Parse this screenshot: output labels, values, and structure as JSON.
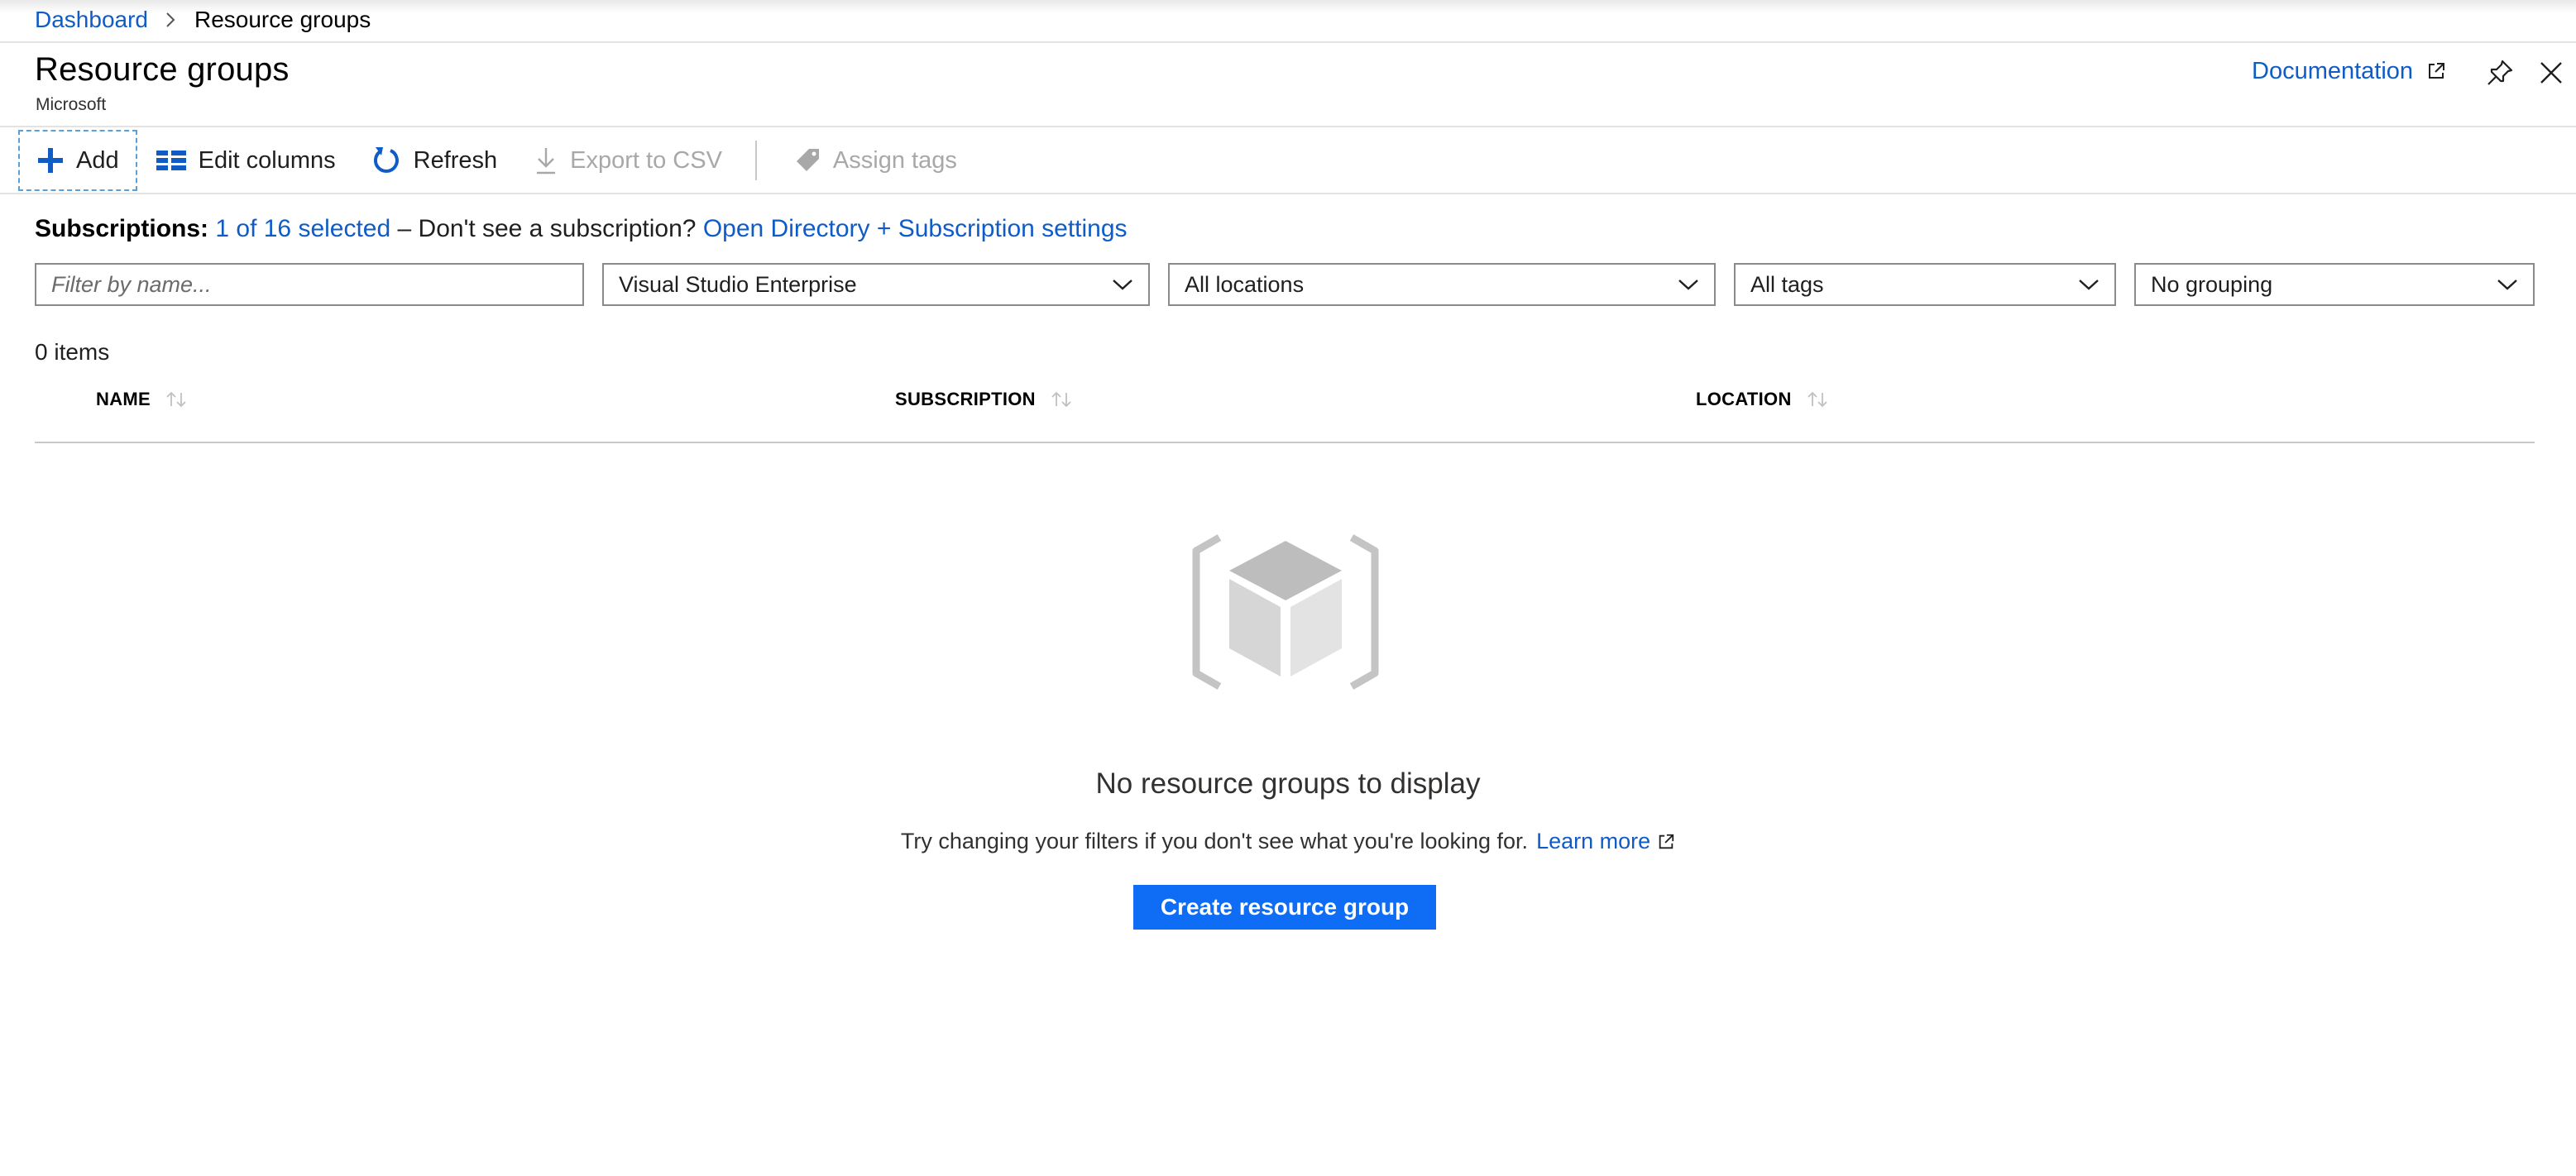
{
  "breadcrumb": {
    "root": "Dashboard",
    "current": "Resource groups"
  },
  "header": {
    "title": "Resource groups",
    "subtitle": "Microsoft",
    "documentation": "Documentation"
  },
  "toolbar": {
    "add": "Add",
    "edit_columns": "Edit columns",
    "refresh": "Refresh",
    "export_csv": "Export to CSV",
    "assign_tags": "Assign tags"
  },
  "subscriptions": {
    "label": "Subscriptions:",
    "selected": "1 of 16 selected",
    "middle": "– Don't see a subscription?",
    "settings_link": "Open Directory + Subscription settings"
  },
  "filters": {
    "name_placeholder": "Filter by name...",
    "subscription": "Visual Studio Enterprise",
    "location": "All locations",
    "tags": "All tags",
    "grouping": "No grouping"
  },
  "items_count": "0 items",
  "table": {
    "columns": [
      "NAME",
      "SUBSCRIPTION",
      "LOCATION"
    ]
  },
  "empty_state": {
    "title": "No resource groups to display",
    "description": "Try changing your filters if you don't see what you're looking for.",
    "learn_more": "Learn more",
    "create_button": "Create resource group"
  },
  "colors": {
    "accent": "#0f6cf5",
    "link": "#0f5cc7",
    "disabled": "#a8a8a8"
  }
}
